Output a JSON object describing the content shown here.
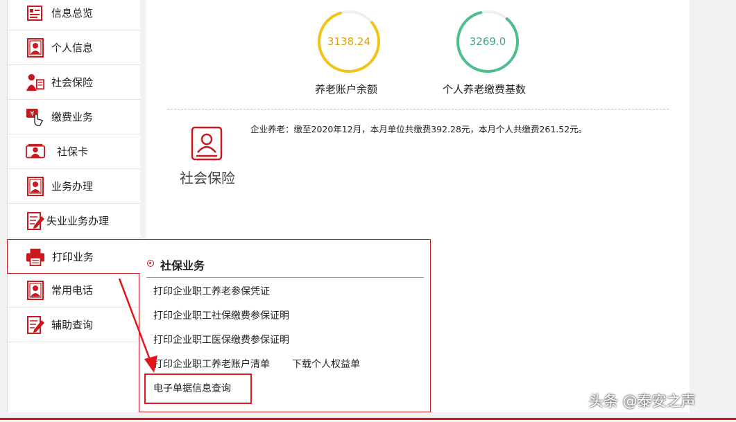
{
  "sidebar": {
    "items": [
      {
        "label": "信息总览",
        "icon": "overview-icon"
      },
      {
        "label": "个人信息",
        "icon": "person-card-icon"
      },
      {
        "label": "社会保险",
        "icon": "social-insurance-icon"
      },
      {
        "label": "缴费业务",
        "icon": "payment-hand-icon"
      },
      {
        "label": "社保卡",
        "icon": "id-card-icon"
      },
      {
        "label": "业务办理",
        "icon": "person-card-icon"
      },
      {
        "label": "失业业务办理",
        "icon": "edit-document-icon"
      },
      {
        "label": "打印业务",
        "icon": "printer-icon"
      },
      {
        "label": "常用电话",
        "icon": "person-card-icon"
      },
      {
        "label": "辅助查询",
        "icon": "edit-document-icon"
      }
    ]
  },
  "main": {
    "gauges": [
      {
        "value": "3138.24",
        "label": "养老账户余额",
        "color": "#f0c419"
      },
      {
        "value": "3269.0",
        "label": "个人养老缴费基数",
        "color": "#4cbf8a"
      }
    ],
    "insurance_section": {
      "title": "社会保险",
      "summary": "企业养老：缴至2020年12月，本月单位共缴费392.28元，本月个人共缴费261.52元。"
    }
  },
  "dropdown": {
    "title": "社保业务",
    "links": [
      "打印企业职工养老参保凭证",
      "打印企业职工社保缴费参保证明",
      "打印企业职工医保缴费参保证明",
      "打印企业职工养老账户清单",
      "下载个人权益单",
      "电子单据信息查询"
    ]
  },
  "watermark": "头条 @泰安之声",
  "colors": {
    "accent": "#c9191e",
    "annotation_red": "#e0171c"
  }
}
